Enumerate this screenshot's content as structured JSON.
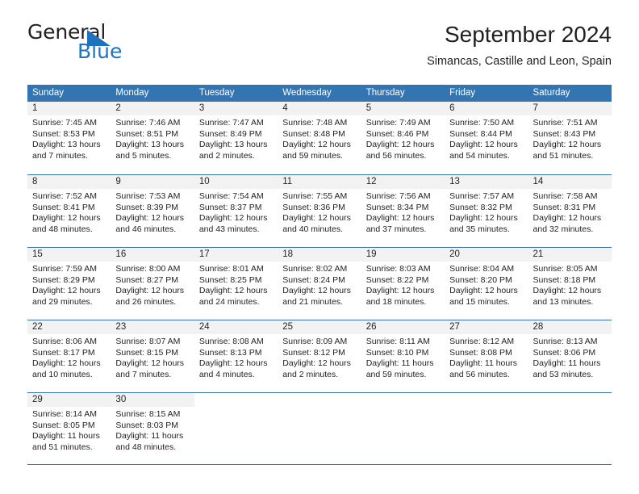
{
  "brand": {
    "name_part1": "General",
    "name_part2": "Blue"
  },
  "header": {
    "title": "September 2024",
    "subtitle": "Simancas, Castille and Leon, Spain"
  },
  "calendar": {
    "weekdays": [
      "Sunday",
      "Monday",
      "Tuesday",
      "Wednesday",
      "Thursday",
      "Friday",
      "Saturday"
    ],
    "colors": {
      "header_blue": "#3275b1",
      "daynum_gray": "#f2f2f2",
      "text": "#231f20",
      "logo_blue": "#1f73be"
    },
    "weeks": [
      [
        {
          "day": "1",
          "sunrise": "Sunrise: 7:45 AM",
          "sunset": "Sunset: 8:53 PM",
          "daylight": "Daylight: 13 hours and 7 minutes."
        },
        {
          "day": "2",
          "sunrise": "Sunrise: 7:46 AM",
          "sunset": "Sunset: 8:51 PM",
          "daylight": "Daylight: 13 hours and 5 minutes."
        },
        {
          "day": "3",
          "sunrise": "Sunrise: 7:47 AM",
          "sunset": "Sunset: 8:49 PM",
          "daylight": "Daylight: 13 hours and 2 minutes."
        },
        {
          "day": "4",
          "sunrise": "Sunrise: 7:48 AM",
          "sunset": "Sunset: 8:48 PM",
          "daylight": "Daylight: 12 hours and 59 minutes."
        },
        {
          "day": "5",
          "sunrise": "Sunrise: 7:49 AM",
          "sunset": "Sunset: 8:46 PM",
          "daylight": "Daylight: 12 hours and 56 minutes."
        },
        {
          "day": "6",
          "sunrise": "Sunrise: 7:50 AM",
          "sunset": "Sunset: 8:44 PM",
          "daylight": "Daylight: 12 hours and 54 minutes."
        },
        {
          "day": "7",
          "sunrise": "Sunrise: 7:51 AM",
          "sunset": "Sunset: 8:43 PM",
          "daylight": "Daylight: 12 hours and 51 minutes."
        }
      ],
      [
        {
          "day": "8",
          "sunrise": "Sunrise: 7:52 AM",
          "sunset": "Sunset: 8:41 PM",
          "daylight": "Daylight: 12 hours and 48 minutes."
        },
        {
          "day": "9",
          "sunrise": "Sunrise: 7:53 AM",
          "sunset": "Sunset: 8:39 PM",
          "daylight": "Daylight: 12 hours and 46 minutes."
        },
        {
          "day": "10",
          "sunrise": "Sunrise: 7:54 AM",
          "sunset": "Sunset: 8:37 PM",
          "daylight": "Daylight: 12 hours and 43 minutes."
        },
        {
          "day": "11",
          "sunrise": "Sunrise: 7:55 AM",
          "sunset": "Sunset: 8:36 PM",
          "daylight": "Daylight: 12 hours and 40 minutes."
        },
        {
          "day": "12",
          "sunrise": "Sunrise: 7:56 AM",
          "sunset": "Sunset: 8:34 PM",
          "daylight": "Daylight: 12 hours and 37 minutes."
        },
        {
          "day": "13",
          "sunrise": "Sunrise: 7:57 AM",
          "sunset": "Sunset: 8:32 PM",
          "daylight": "Daylight: 12 hours and 35 minutes."
        },
        {
          "day": "14",
          "sunrise": "Sunrise: 7:58 AM",
          "sunset": "Sunset: 8:31 PM",
          "daylight": "Daylight: 12 hours and 32 minutes."
        }
      ],
      [
        {
          "day": "15",
          "sunrise": "Sunrise: 7:59 AM",
          "sunset": "Sunset: 8:29 PM",
          "daylight": "Daylight: 12 hours and 29 minutes."
        },
        {
          "day": "16",
          "sunrise": "Sunrise: 8:00 AM",
          "sunset": "Sunset: 8:27 PM",
          "daylight": "Daylight: 12 hours and 26 minutes."
        },
        {
          "day": "17",
          "sunrise": "Sunrise: 8:01 AM",
          "sunset": "Sunset: 8:25 PM",
          "daylight": "Daylight: 12 hours and 24 minutes."
        },
        {
          "day": "18",
          "sunrise": "Sunrise: 8:02 AM",
          "sunset": "Sunset: 8:24 PM",
          "daylight": "Daylight: 12 hours and 21 minutes."
        },
        {
          "day": "19",
          "sunrise": "Sunrise: 8:03 AM",
          "sunset": "Sunset: 8:22 PM",
          "daylight": "Daylight: 12 hours and 18 minutes."
        },
        {
          "day": "20",
          "sunrise": "Sunrise: 8:04 AM",
          "sunset": "Sunset: 8:20 PM",
          "daylight": "Daylight: 12 hours and 15 minutes."
        },
        {
          "day": "21",
          "sunrise": "Sunrise: 8:05 AM",
          "sunset": "Sunset: 8:18 PM",
          "daylight": "Daylight: 12 hours and 13 minutes."
        }
      ],
      [
        {
          "day": "22",
          "sunrise": "Sunrise: 8:06 AM",
          "sunset": "Sunset: 8:17 PM",
          "daylight": "Daylight: 12 hours and 10 minutes."
        },
        {
          "day": "23",
          "sunrise": "Sunrise: 8:07 AM",
          "sunset": "Sunset: 8:15 PM",
          "daylight": "Daylight: 12 hours and 7 minutes."
        },
        {
          "day": "24",
          "sunrise": "Sunrise: 8:08 AM",
          "sunset": "Sunset: 8:13 PM",
          "daylight": "Daylight: 12 hours and 4 minutes."
        },
        {
          "day": "25",
          "sunrise": "Sunrise: 8:09 AM",
          "sunset": "Sunset: 8:12 PM",
          "daylight": "Daylight: 12 hours and 2 minutes."
        },
        {
          "day": "26",
          "sunrise": "Sunrise: 8:11 AM",
          "sunset": "Sunset: 8:10 PM",
          "daylight": "Daylight: 11 hours and 59 minutes."
        },
        {
          "day": "27",
          "sunrise": "Sunrise: 8:12 AM",
          "sunset": "Sunset: 8:08 PM",
          "daylight": "Daylight: 11 hours and 56 minutes."
        },
        {
          "day": "28",
          "sunrise": "Sunrise: 8:13 AM",
          "sunset": "Sunset: 8:06 PM",
          "daylight": "Daylight: 11 hours and 53 minutes."
        }
      ],
      [
        {
          "day": "29",
          "sunrise": "Sunrise: 8:14 AM",
          "sunset": "Sunset: 8:05 PM",
          "daylight": "Daylight: 11 hours and 51 minutes."
        },
        {
          "day": "30",
          "sunrise": "Sunrise: 8:15 AM",
          "sunset": "Sunset: 8:03 PM",
          "daylight": "Daylight: 11 hours and 48 minutes."
        },
        {
          "day": "",
          "sunrise": "",
          "sunset": "",
          "daylight": ""
        },
        {
          "day": "",
          "sunrise": "",
          "sunset": "",
          "daylight": ""
        },
        {
          "day": "",
          "sunrise": "",
          "sunset": "",
          "daylight": ""
        },
        {
          "day": "",
          "sunrise": "",
          "sunset": "",
          "daylight": ""
        },
        {
          "day": "",
          "sunrise": "",
          "sunset": "",
          "daylight": ""
        }
      ]
    ]
  }
}
